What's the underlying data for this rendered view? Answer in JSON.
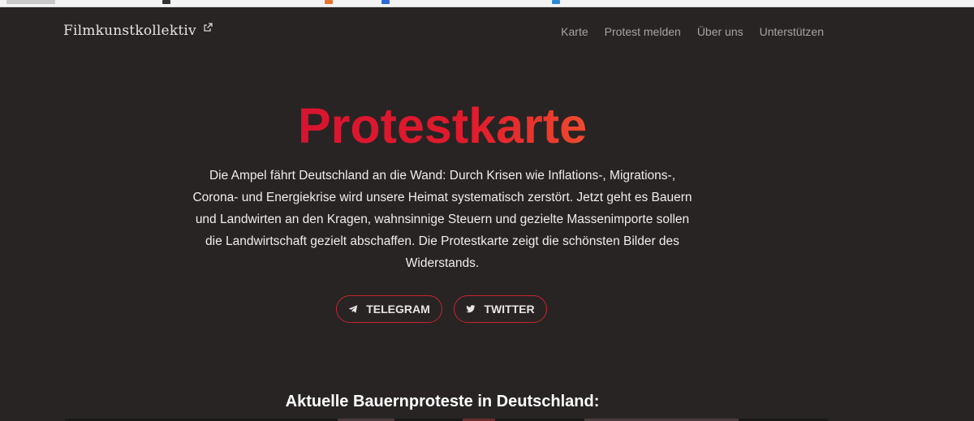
{
  "navbar": {
    "brand": "Filmkunstkollektiv",
    "links": [
      "Karte",
      "Protest melden",
      "Über uns",
      "Unterstützen"
    ]
  },
  "hero": {
    "title": "Protestkarte",
    "description": "Die Ampel fährt Deutschland an die Wand: Durch Krisen wie Inflations-, Migrations-, Corona- und Energiekrise wird unsere Heimat systematisch zerstört. Jetzt geht es Bauern und Landwirten an den Kragen, wahnsinnige Steuern und gezielte Massenimporte sollen die Landwirtschaft gezielt abschaffen. Die Protestkarte zeigt die schönsten Bilder des Widerstands.",
    "buttons": {
      "telegram": "TELEGRAM",
      "twitter": "TWITTER"
    }
  },
  "section": {
    "title": "Aktuelle Bauernproteste in Deutschland:"
  },
  "colors": {
    "background": "#282424",
    "accent": "#e11b2c",
    "button_border": "#c72430"
  }
}
